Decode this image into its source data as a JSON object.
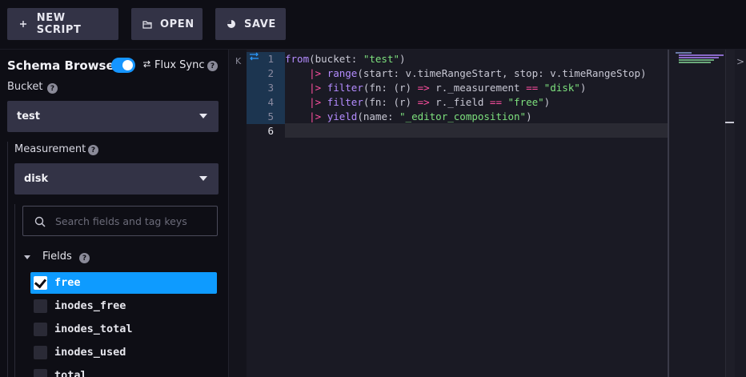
{
  "toolbar": {
    "new_script": {
      "label": "NEW SCRIPT",
      "icon": "plus-icon"
    },
    "open": {
      "label": "OPEN",
      "icon": "folder-icon"
    },
    "save": {
      "label": "SAVE",
      "icon": "save-icon"
    }
  },
  "schema_browser": {
    "title": "Schema Browser",
    "flux_sync": {
      "label": "Flux Sync",
      "enabled": true,
      "icon": "sync-arrows-icon"
    },
    "bucket": {
      "label": "Bucket",
      "selected": "test"
    },
    "measurement": {
      "label": "Measurement",
      "selected": "disk"
    },
    "search": {
      "placeholder": "Search fields and tag keys"
    },
    "fields": {
      "label": "Fields",
      "items": [
        {
          "name": "free",
          "checked": true
        },
        {
          "name": "inodes_free",
          "checked": false
        },
        {
          "name": "inodes_total",
          "checked": false
        },
        {
          "name": "inodes_used",
          "checked": false
        },
        {
          "name": "total",
          "checked": false
        }
      ]
    }
  },
  "editor": {
    "line_numbers": [
      "1",
      "2",
      "3",
      "4",
      "5",
      "6"
    ],
    "lines": [
      [
        [
          "kw",
          "from"
        ],
        [
          "pl",
          "(bucket: "
        ],
        [
          "str",
          "\"test\""
        ],
        [
          "pl",
          ")"
        ]
      ],
      [
        [
          "pl",
          "    "
        ],
        [
          "op",
          "|>"
        ],
        [
          "pl",
          " "
        ],
        [
          "fn",
          "range"
        ],
        [
          "pl",
          "(start: v.timeRangeStart, stop: v.timeRangeStop)"
        ]
      ],
      [
        [
          "pl",
          "    "
        ],
        [
          "op",
          "|>"
        ],
        [
          "pl",
          " "
        ],
        [
          "fn",
          "filter"
        ],
        [
          "pl",
          "(fn: (r) "
        ],
        [
          "op",
          "=>"
        ],
        [
          "pl",
          " r._measurement "
        ],
        [
          "op",
          "=="
        ],
        [
          "pl",
          " "
        ],
        [
          "str",
          "\"disk\""
        ],
        [
          "pl",
          ")"
        ]
      ],
      [
        [
          "pl",
          "    "
        ],
        [
          "op",
          "|>"
        ],
        [
          "pl",
          " "
        ],
        [
          "fn",
          "filter"
        ],
        [
          "pl",
          "(fn: (r) "
        ],
        [
          "op",
          "=>"
        ],
        [
          "pl",
          " r._field "
        ],
        [
          "op",
          "=="
        ],
        [
          "pl",
          " "
        ],
        [
          "str",
          "\"free\""
        ],
        [
          "pl",
          ")"
        ]
      ],
      [
        [
          "pl",
          "    "
        ],
        [
          "op",
          "|>"
        ],
        [
          "pl",
          " "
        ],
        [
          "fn",
          "yield"
        ],
        [
          "pl",
          "(name: "
        ],
        [
          "str",
          "\"_editor_composition\""
        ],
        [
          "pl",
          ")"
        ]
      ],
      []
    ]
  },
  "colors": {
    "accent": "#0e9bff",
    "keyword": "#b48cff",
    "operator": "#ff4fa0",
    "string": "#7de07d"
  }
}
